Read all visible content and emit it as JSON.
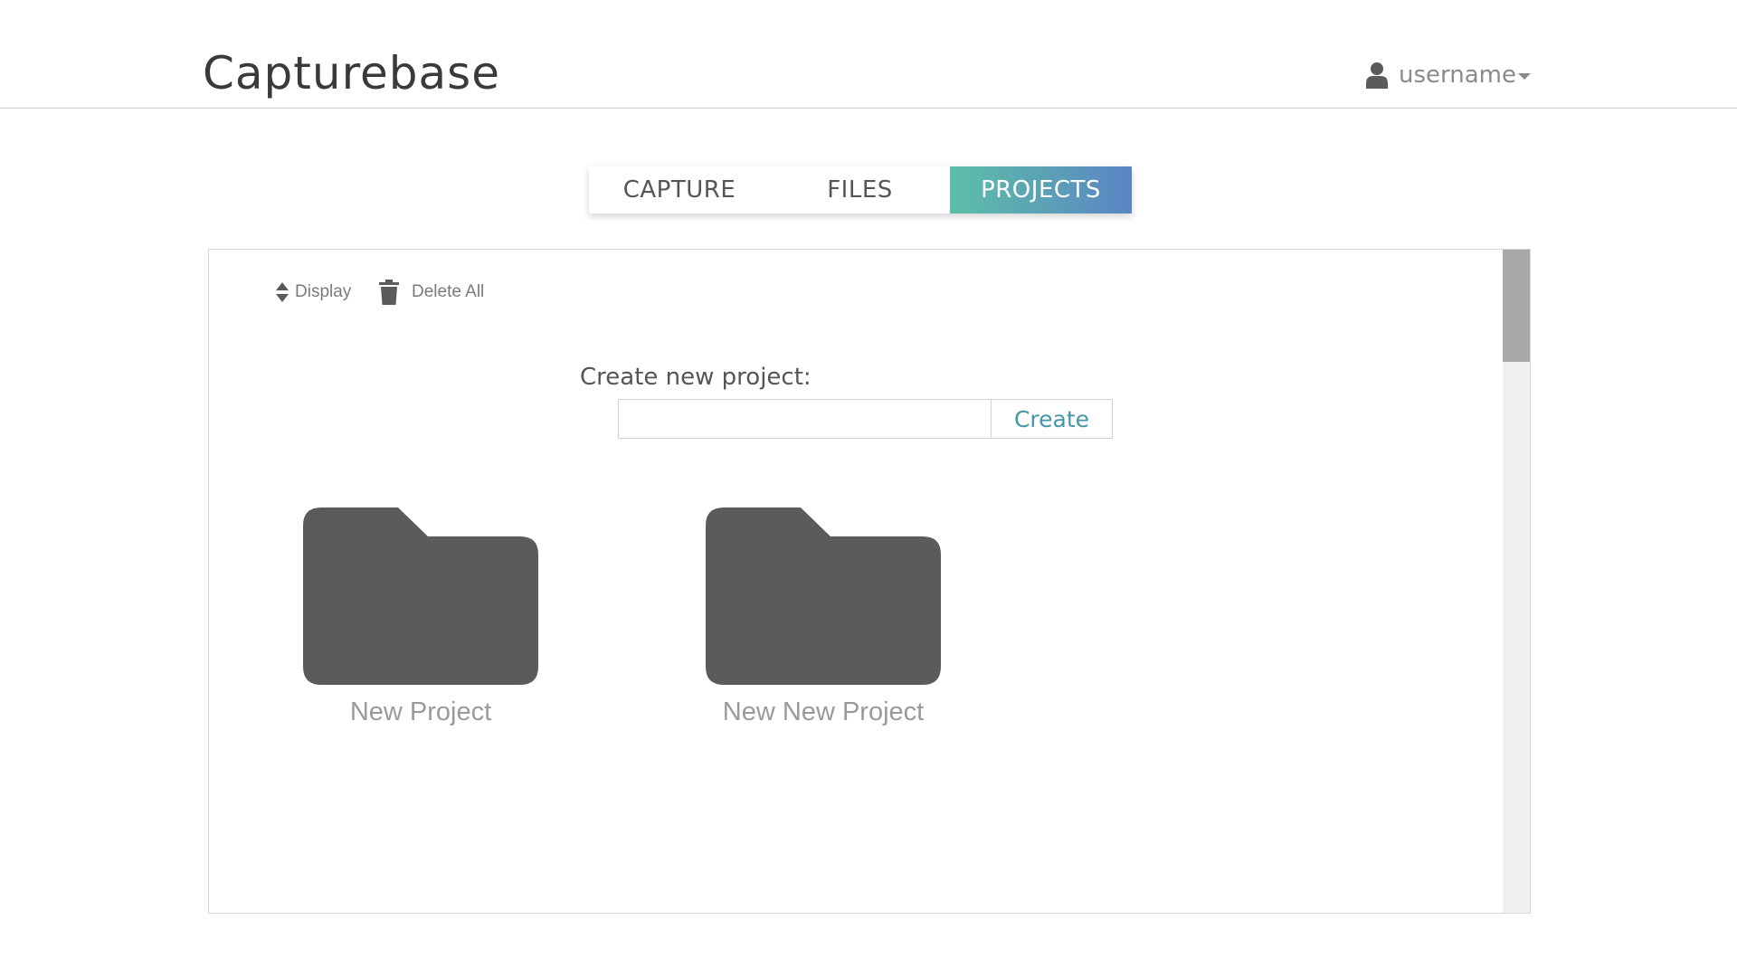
{
  "header": {
    "brand": "Capturebase",
    "username": "username",
    "icons": {
      "user": "user-icon",
      "caret": "caret-down-icon"
    }
  },
  "tabs": [
    {
      "label": "CAPTURE",
      "active": false
    },
    {
      "label": "FILES",
      "active": false
    },
    {
      "label": "PROJECTS",
      "active": true
    }
  ],
  "toolbar": {
    "display_label": "Display",
    "delete_all_label": "Delete All",
    "icons": {
      "display": "sort-icon",
      "delete_all": "trash-icon"
    }
  },
  "create_form": {
    "label": "Create new project:",
    "input_value": "",
    "input_placeholder": "",
    "button_label": "Create"
  },
  "projects": [
    {
      "name": "New Project",
      "icon": "folder-icon"
    },
    {
      "name": "New New Project",
      "icon": "folder-icon"
    }
  ],
  "colors": {
    "active_tab_gradient_start": "#5cbfa6",
    "active_tab_gradient_end": "#5b85c4",
    "create_button_text": "#4596a8",
    "folder": "#5b5b5b"
  }
}
